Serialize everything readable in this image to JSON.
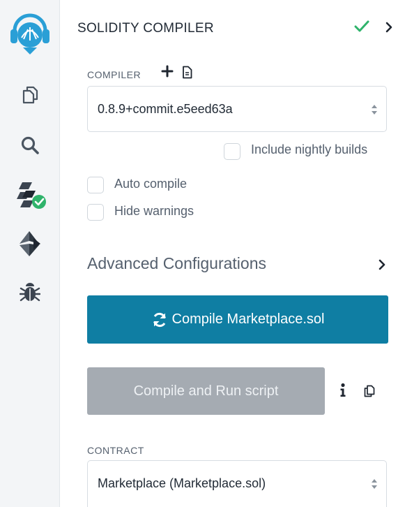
{
  "panel": {
    "title": "SOLIDITY COMPILER"
  },
  "rail": {
    "items": [
      {
        "name": "remix-logo-icon"
      },
      {
        "name": "file-explorer-icon"
      },
      {
        "name": "search-icon"
      },
      {
        "name": "solidity-compiler-icon"
      },
      {
        "name": "deploy-run-icon"
      },
      {
        "name": "debugger-icon"
      }
    ]
  },
  "compiler": {
    "label": "COMPILER",
    "selected_version": "0.8.9+commit.e5eed63a",
    "include_nightly_label": "Include nightly builds",
    "auto_compile_label": "Auto compile",
    "hide_warnings_label": "Hide warnings"
  },
  "advanced": {
    "label": "Advanced Configurations"
  },
  "buttons": {
    "compile_label": "Compile Marketplace.sol",
    "run_script_label": "Compile and Run script"
  },
  "contract": {
    "label": "CONTRACT",
    "selected": "Marketplace (Marketplace.sol)"
  },
  "colors": {
    "accent": "#0f7ea3",
    "success": "#2fb36b",
    "disabled_button": "#a5abb2",
    "logo": "#2a9fd6"
  }
}
